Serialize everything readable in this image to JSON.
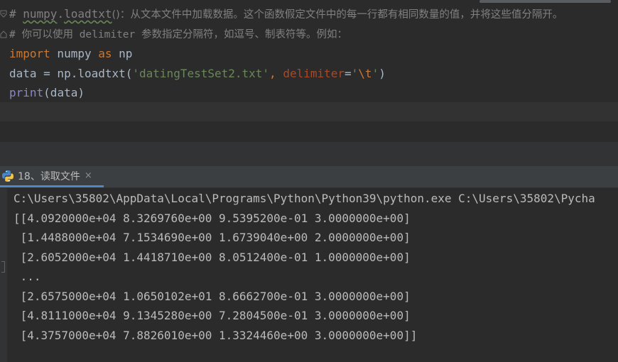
{
  "editor": {
    "comment1_prefix": "# ",
    "comment1_mod": "numpy",
    "comment1_dot": ".",
    "comment1_fn": "loadtxt",
    "comment1_rest": "()：从文本文件中加载数据。这个函数假定文件中的每一行都有相同数量的值，并将这些值分隔开。",
    "comment2": "# 你可以使用 delimiter 参数指定分隔符，如逗号、制表符等。例如：",
    "line3_kw1": "import",
    "line3_mod": " numpy ",
    "line3_kw2": "as",
    "line3_alias": " np",
    "line4_pre": "data = np.loadtxt(",
    "line4_str": "'datingTestSet2.txt'",
    "line4_comma": ", ",
    "line4_param": "delimiter",
    "line4_eq": "=",
    "line4_q1": "'",
    "line4_esc": "\\t",
    "line4_q2": "'",
    "line4_close": ")",
    "line5_fn": "print",
    "line5_rest": "(data)"
  },
  "run_tab": {
    "label": "18、读取文件",
    "close": "×",
    "icon": "python-icon"
  },
  "console": {
    "lines": [
      "C:\\Users\\35802\\AppData\\Local\\Programs\\Python\\Python39\\python.exe C:\\Users\\35802\\Pycha",
      "[[4.0920000e+04 8.3269760e+00 9.5395200e-01 3.0000000e+00]",
      " [1.4488000e+04 7.1534690e+00 1.6739040e+00 2.0000000e+00]",
      " [2.6052000e+04 1.4418710e+00 8.0512400e-01 1.0000000e+00]",
      " ...",
      " [2.6575000e+04 1.0650102e+01 8.6662700e-01 3.0000000e+00]",
      " [4.8111000e+04 9.1345280e+00 7.2804500e-01 3.0000000e+00]",
      " [4.3757000e+04 7.8826010e+00 1.3324460e+00 3.0000000e+00]]"
    ]
  }
}
